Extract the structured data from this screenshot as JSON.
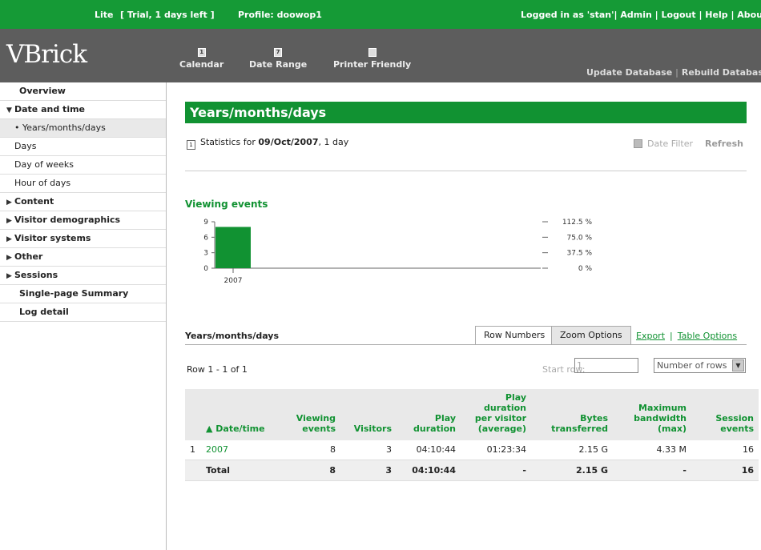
{
  "topbar": {
    "edition": "Lite",
    "trial": "[ Trial, 1 days left ]",
    "profile": "Profile: doowop1",
    "logged_in": "Logged in as 'stan'",
    "admin": "Admin",
    "logout": "Logout",
    "help": "Help",
    "about": "About"
  },
  "header": {
    "logo": "VBrick",
    "tools": [
      {
        "label": "Calendar",
        "icon": "calendar-icon"
      },
      {
        "label": "Date Range",
        "icon": "date-range-icon"
      },
      {
        "label": "Printer Friendly",
        "icon": "printer-icon"
      }
    ],
    "update_db": "Update Database",
    "rebuild_db": "Rebuild Database"
  },
  "sidebar": {
    "items": [
      {
        "label": "Overview"
      },
      {
        "label": "Date and time"
      },
      {
        "label": "Years/months/days"
      },
      {
        "label": "Days"
      },
      {
        "label": "Day of weeks"
      },
      {
        "label": "Hour of days"
      },
      {
        "label": "Content"
      },
      {
        "label": "Visitor demographics"
      },
      {
        "label": "Visitor systems"
      },
      {
        "label": "Other"
      },
      {
        "label": "Sessions"
      },
      {
        "label": "Single-page Summary"
      },
      {
        "label": "Log detail"
      }
    ]
  },
  "main": {
    "title": "Years/months/days",
    "stats_prefix": "Statistics for",
    "stats_date": "09/Oct/2007",
    "stats_suffix": ", 1 day",
    "date_filter": "Date Filter",
    "refresh": "Refresh",
    "chart_title": "Viewing events",
    "table_title": "Years/months/days",
    "tab_rows": "Row Numbers",
    "tab_zoom": "Zoom Options",
    "export": "Export",
    "table_options": "Table Options",
    "row_count": "Row 1 - 1 of 1",
    "start_row_label": "Start row:",
    "start_row_value": "1",
    "num_rows": "Number of rows",
    "columns": [
      "▲ Date/time",
      "Viewing events",
      "Visitors",
      "Play duration",
      "Play duration per visitor (average)",
      "Bytes transferred",
      "Maximum bandwidth (max)",
      "Session events"
    ],
    "rows": [
      {
        "idx": "1",
        "date": "2007",
        "viewing": "8",
        "visitors": "3",
        "play": "04:10:44",
        "per_visitor": "01:23:34",
        "bytes": "2.15 G",
        "bandwidth": "4.33 M",
        "sessions": "16"
      }
    ],
    "total": {
      "label": "Total",
      "viewing": "8",
      "visitors": "3",
      "play": "04:10:44",
      "per_visitor": "-",
      "bytes": "2.15 G",
      "bandwidth": "-",
      "sessions": "16"
    }
  },
  "chart_data": {
    "type": "bar",
    "title": "Viewing events",
    "categories": [
      "2007"
    ],
    "values": [
      8
    ],
    "ylim": [
      0,
      9
    ],
    "yticks": [
      "9",
      "6",
      "3",
      "0"
    ],
    "right_ticks": [
      "112.5 %",
      "75.0 %",
      "37.5 %",
      "0 %"
    ],
    "bar_color": "#119232"
  }
}
